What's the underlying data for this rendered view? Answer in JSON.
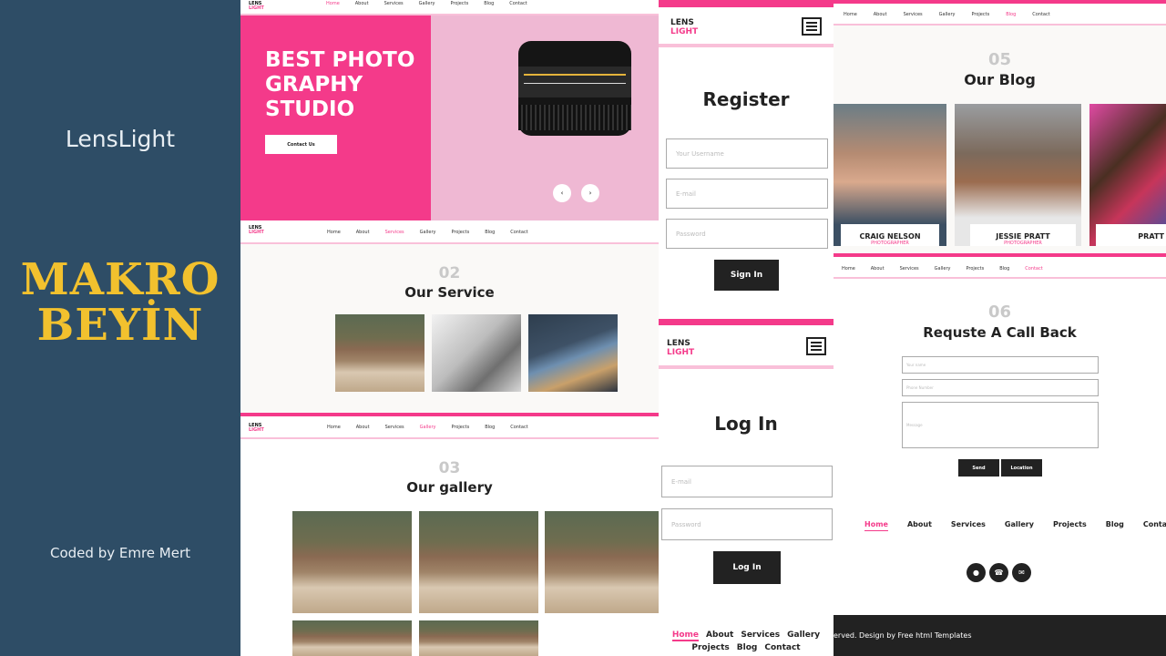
{
  "sidebar": {
    "app_title": "LensLight",
    "brand_line1": "MAKRO",
    "brand_line2": "BEYİN",
    "credit": "Coded by Emre Mert"
  },
  "logo": {
    "line1": "LENS",
    "line2": "LIGHT"
  },
  "nav": [
    "Home",
    "About",
    "Services",
    "Gallery",
    "Projects",
    "Blog",
    "Contact"
  ],
  "hero": {
    "title_l1": "BEST PHOTO",
    "title_l2": "GRAPHY",
    "title_l3": "STUDIO",
    "cta": "Contact Us"
  },
  "service": {
    "num": "02",
    "title": "Our Service"
  },
  "gallery": {
    "num": "03",
    "title": "Our gallery"
  },
  "register": {
    "title": "Register",
    "username_ph": "Your Username",
    "email_ph": "E-mail",
    "password_ph": "Password",
    "submit": "Sign In"
  },
  "login": {
    "title": "Log In",
    "email_ph": "E-mail",
    "password_ph": "Password",
    "submit": "Log In"
  },
  "mobile_nav": {
    "row1": [
      "Home",
      "About",
      "Services",
      "Gallery"
    ],
    "row2": [
      "Projects",
      "Blog",
      "Contact"
    ]
  },
  "blog": {
    "num": "05",
    "title": "Our Blog",
    "people": [
      {
        "name": "CRAIG NELSON",
        "role": "PHOTOGRAPHER"
      },
      {
        "name": "JESSIE PRATT",
        "role": "PHOTOGRAPHER"
      },
      {
        "name": "PRATT",
        "role": ""
      }
    ]
  },
  "callback": {
    "num": "06",
    "title": "Requste A Call Back",
    "name_ph": "Your name",
    "phone_ph": "Phone Number",
    "msg_ph": "Message",
    "send": "Send",
    "location": "Location"
  },
  "footer": {
    "copyright": "erved. Design by Free html Templates"
  },
  "colors": {
    "accent": "#f43a8a",
    "sidebar": "#2e4d66",
    "brand_yellow": "#f2c12e"
  }
}
